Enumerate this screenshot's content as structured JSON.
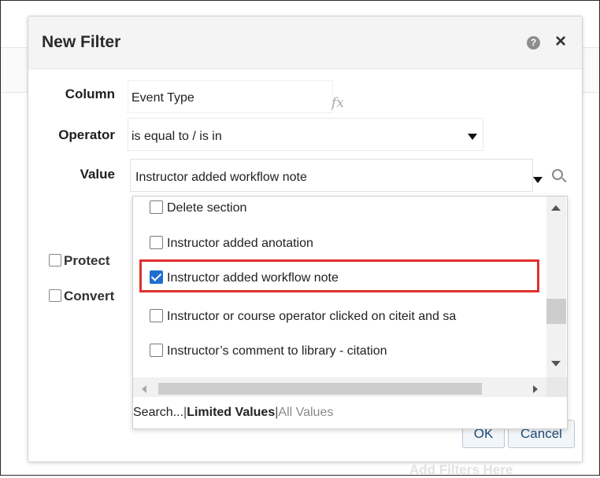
{
  "background": {
    "add_filters_text": "Add Filters Here"
  },
  "dialog": {
    "title": "New Filter",
    "help_icon": "question-circle-icon",
    "help_glyph": "?",
    "close_icon": "close-icon",
    "close_glyph": "×"
  },
  "form": {
    "column_label": "Column",
    "column_value": "Event Type",
    "fx_glyph": "fx",
    "operator_label": "Operator",
    "operator_value": "is equal to / is in",
    "value_label": "Value",
    "value_value": "Instructor added workflow note"
  },
  "options": {
    "protect_label": "Protect",
    "convert_label": "Convert"
  },
  "dropdown": {
    "items": [
      {
        "label": "Delete section",
        "checked": false
      },
      {
        "label": "Instructor added anotation",
        "checked": false
      },
      {
        "label": "Instructor added workflow note",
        "checked": true
      },
      {
        "label": "Instructor or course operator clicked on citeit and sa",
        "checked": false
      },
      {
        "label": "Instructor’s comment to library - citation",
        "checked": false
      }
    ],
    "footer": {
      "search": "Search...",
      "sep1": "|",
      "limited": "Limited Values",
      "sep2": "|",
      "all": "All Values"
    }
  },
  "buttons": {
    "ok": "OK",
    "cancel": "Cancel"
  },
  "colors": {
    "highlight": "#e0302e",
    "checkbox_checked": "#1e6fd1"
  }
}
